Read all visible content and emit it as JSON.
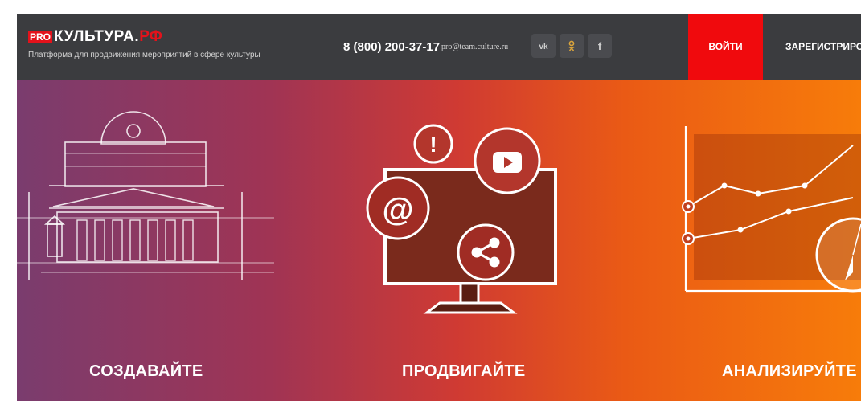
{
  "header": {
    "logo_pro": "PRO",
    "logo_name": "КУЛЬТУРА.",
    "logo_rf": "РФ",
    "tagline": "Платформа для продвижения мероприятий в сфере культуры",
    "phone": "8 (800) 200-37-17",
    "email": "pro@team.culture.ru",
    "social": [
      "vk-icon",
      "odnoklassniki-icon",
      "facebook-icon"
    ],
    "login_label": "ВОЙТИ",
    "register_label": "ЗАРЕГИСТРИРОВАТЬСЯ"
  },
  "hero": {
    "items": [
      {
        "caption": "СОЗДАВАЙТЕ",
        "icon": "theater-building-icon"
      },
      {
        "caption": "ПРОДВИГАЙТЕ",
        "icon": "monitor-promotion-icon"
      },
      {
        "caption": "АНАЛИЗИРУЙТЕ",
        "icon": "analytics-chart-icon"
      }
    ]
  },
  "colors": {
    "header_bg": "#3b3c3f",
    "accent_red": "#f00a0d",
    "gradient_start": "#7a3c6e",
    "gradient_end": "#f77c0a"
  }
}
